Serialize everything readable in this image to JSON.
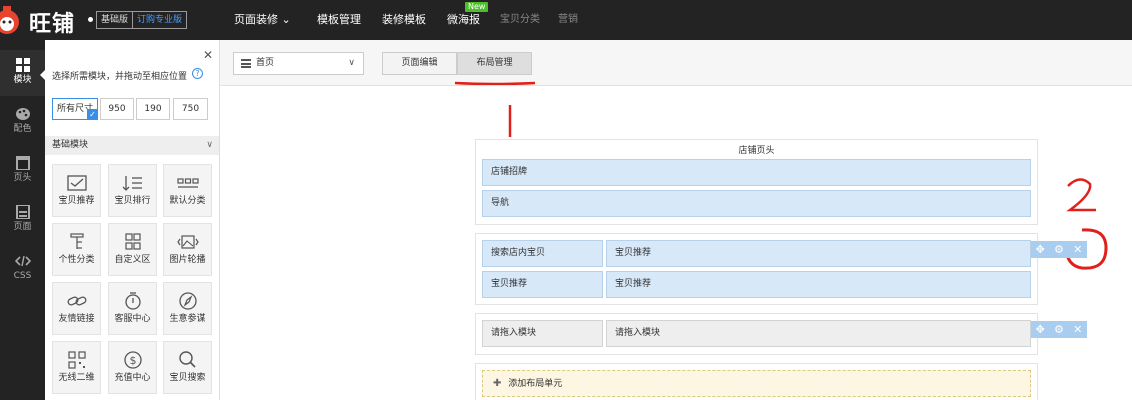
{
  "topbar": {
    "logo": "旺铺",
    "version_basic": "基础版",
    "version_pro": "订购专业版",
    "nav": [
      {
        "label": "页面装修 ⌄"
      },
      {
        "label": "模板管理"
      },
      {
        "label": "装修模板"
      },
      {
        "label": "微海报",
        "badge": "New"
      },
      {
        "label": "宝贝分类"
      },
      {
        "label": "营销"
      }
    ]
  },
  "sidebar": {
    "items": [
      {
        "label": "模块",
        "icon": "grid-icon"
      },
      {
        "label": "配色",
        "icon": "palette-icon"
      },
      {
        "label": "页头",
        "icon": "header-icon"
      },
      {
        "label": "页面",
        "icon": "page-icon"
      },
      {
        "label": "CSS",
        "icon": "code-icon"
      }
    ]
  },
  "panel": {
    "hint": "选择所需模块，并拖动至相应位置",
    "sizes": [
      "所有尺寸",
      "950",
      "190",
      "750"
    ],
    "section_title": "基础模块",
    "modules": [
      {
        "label": "宝贝推荐",
        "icon": "image-frame-icon"
      },
      {
        "label": "宝贝排行",
        "icon": "sort-list-icon"
      },
      {
        "label": "默认分类",
        "icon": "category-icon"
      },
      {
        "label": "个性分类",
        "icon": "tree-icon"
      },
      {
        "label": "自定义区",
        "icon": "custom-grid-icon"
      },
      {
        "label": "图片轮播",
        "icon": "carousel-icon"
      },
      {
        "label": "友情链接",
        "icon": "link-icon"
      },
      {
        "label": "客服中心",
        "icon": "service-icon"
      },
      {
        "label": "生意参谋",
        "icon": "compass-icon"
      },
      {
        "label": "无线二维",
        "icon": "qr-icon"
      },
      {
        "label": "充值中心",
        "icon": "dollar-icon"
      },
      {
        "label": "宝贝搜索",
        "icon": "search-icon"
      }
    ]
  },
  "toolbar": {
    "page_select": "首页",
    "tab_edit": "页面编辑",
    "tab_layout": "布局管理"
  },
  "layout": {
    "header_title": "店铺页头",
    "header_slots": [
      "店铺招牌",
      "导航"
    ],
    "row1": [
      "搜索店内宝贝",
      "宝贝推荐"
    ],
    "row2": [
      "宝贝推荐",
      "宝贝推荐"
    ],
    "row3": [
      "请拖入模块",
      "请拖入模块"
    ],
    "add_unit": "添加布局单元"
  },
  "colors": {
    "topbar": "#232323",
    "accent_blue": "#3a8ee6",
    "slot_blue": "#d7e8f9",
    "annotation_red": "#e0201b",
    "new_badge": "#4cbf2a"
  }
}
